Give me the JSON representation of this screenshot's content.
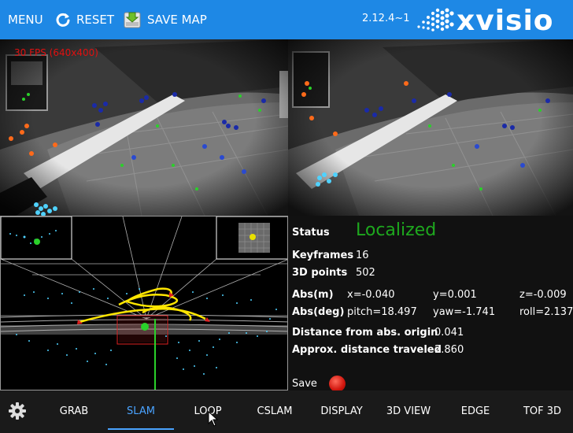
{
  "toolbar": {
    "menu_label": "MENU",
    "reset_label": "RESET",
    "save_map_label": "SAVE MAP",
    "version": "2.12.4~1",
    "logo_text": "xvisio"
  },
  "camera": {
    "fps_overlay": "30 FPS (640x400)"
  },
  "status_panel": {
    "status_label": "Status",
    "status_value": "Localized",
    "keyframes_label": "Keyframes",
    "keyframes_value": "16",
    "points_label": "3D points",
    "points_value": "502",
    "abs_m_label": "Abs(m)",
    "abs_x": "x=-0.040",
    "abs_y": "y=0.001",
    "abs_z": "z=-0.009",
    "abs_deg_label": "Abs(deg)",
    "pitch": "pitch=18.497",
    "yaw": "yaw=-1.741",
    "roll": "roll=2.137",
    "dist_origin_label": "Distance from abs. origin",
    "dist_origin_value": "0.041",
    "dist_traveled_label": "Approx. distance traveled",
    "dist_traveled_value": "2.860",
    "save_label": "Save"
  },
  "tabs": [
    "GRAB",
    "SLAM",
    "LOOP",
    "CSLAM",
    "DISPLAY",
    "3D VIEW",
    "EDGE",
    "TOF 3D"
  ],
  "active_tab": "SLAM",
  "colors": {
    "toolbar_bg": "#1e88e5",
    "status_green": "#1ea81e",
    "active_tab": "#4aa3ff",
    "fps_red": "#e01010"
  }
}
